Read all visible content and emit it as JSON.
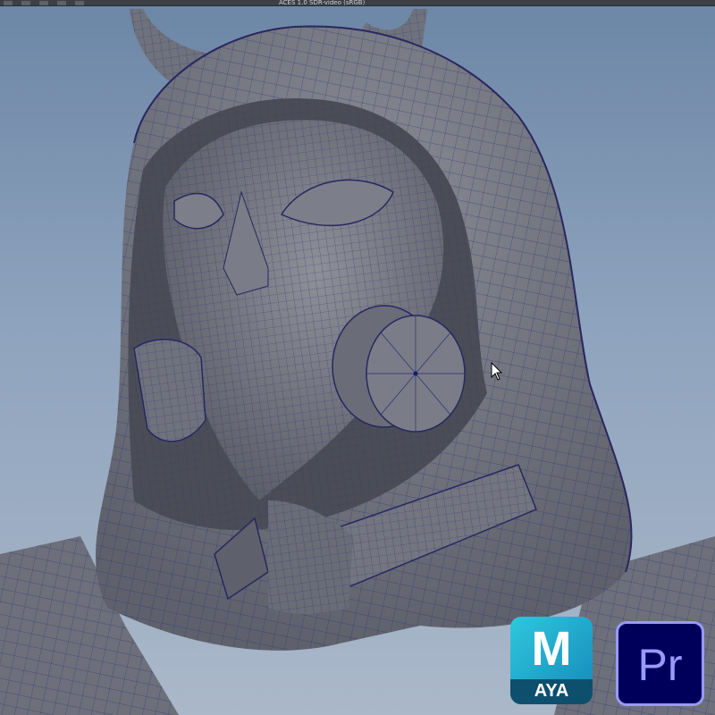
{
  "toolbar": {
    "color_space_label": "ACES 1.0 SDR-video (sRGB)",
    "icons": [
      "wireframe-shading-icon",
      "smooth-shading-icon",
      "lighting-icon",
      "camera-icon",
      "render-icon"
    ]
  },
  "viewport": {
    "background_top": "#6c86a6",
    "background_bottom": "#aab8c9",
    "mesh_color": "#6a6d77",
    "wire_color": "#2f2a78"
  },
  "badges": {
    "maya": {
      "letter": "M",
      "label": "AYA",
      "color": "#1aa3c8"
    },
    "premiere": {
      "label": "Pr",
      "color": "#9999ff",
      "bg": "#00005b"
    }
  }
}
